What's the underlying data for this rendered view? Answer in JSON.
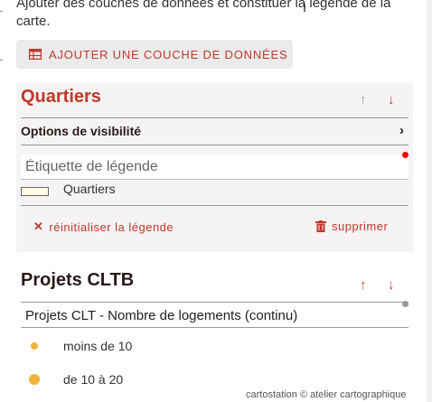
{
  "intro": {
    "text": "Ajouter des couches de données et constituer la légende de la carte."
  },
  "toolbar": {
    "add_layer_label": "AJOUTER UNE COUCHE DE DONNÉES",
    "add_layer_icon": "table-icon"
  },
  "layers": [
    {
      "title": "Quartiers",
      "title_color": "#c0392b",
      "visibility_label": "Options de visibilité",
      "legend_placeholder": "Étiquette de légende",
      "legend_value": "",
      "legend_items": [
        {
          "label": "Quartiers",
          "fill": "#fffbe6"
        }
      ],
      "reset_label": "réinitialiser la légende",
      "delete_label": "supprimer"
    },
    {
      "title": "Projets CLTB",
      "description": "Projets CLT - Nombre de logements (continu)",
      "classes": [
        {
          "label": "moins de 10",
          "color": "#f0b43c"
        },
        {
          "label": "de 10 à 20",
          "color": "#f0b43c"
        }
      ]
    }
  ],
  "colors": {
    "accent": "#c0392b",
    "panel_bg": "#f5f3f4",
    "button_bg": "#ebebeb",
    "required_dot": "#ee0000"
  },
  "footer": {
    "credit": "cartostation © atelier cartographique"
  }
}
